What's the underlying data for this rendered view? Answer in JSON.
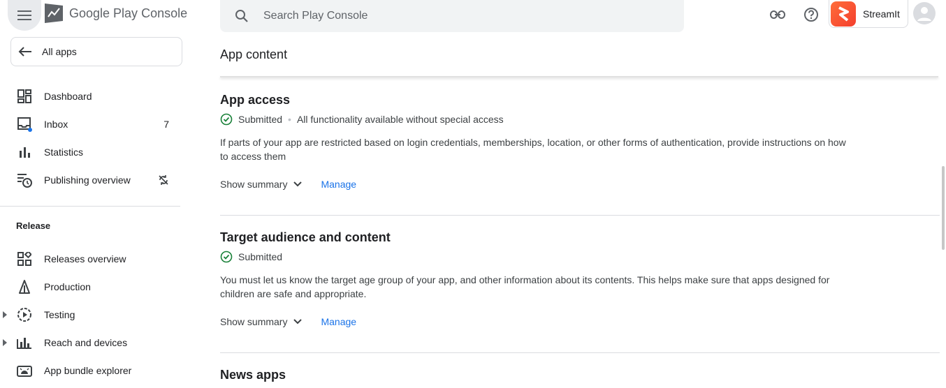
{
  "header": {
    "brand_google": "Google Play",
    "brand_console": "Console",
    "search_placeholder": "Search Play Console",
    "app_name": "StreamIt"
  },
  "sidebar": {
    "all_apps": "All apps",
    "items": [
      {
        "label": "Dashboard",
        "icon": "dashboard-icon"
      },
      {
        "label": "Inbox",
        "icon": "inbox-icon",
        "count": "7"
      },
      {
        "label": "Statistics",
        "icon": "bar-chart-icon"
      },
      {
        "label": "Publishing overview",
        "icon": "schedule-list-icon"
      }
    ],
    "release_label": "Release",
    "release_items": [
      {
        "label": "Releases overview",
        "icon": "releases-overview-icon"
      },
      {
        "label": "Production",
        "icon": "production-icon"
      },
      {
        "label": "Testing",
        "icon": "testing-icon"
      },
      {
        "label": "Reach and devices",
        "icon": "reach-devices-icon"
      },
      {
        "label": "App bundle explorer",
        "icon": "android-icon"
      }
    ]
  },
  "main": {
    "title": "App content",
    "sections": [
      {
        "title": "App access",
        "status": "Submitted",
        "status_detail": "All functionality available without special access",
        "description": "If parts of your app are restricted based on login credentials, memberships, location, or other forms of authentication, provide instructions on how to access them",
        "show_summary": "Show summary",
        "manage": "Manage"
      },
      {
        "title": "Target audience and content",
        "status": "Submitted",
        "description": "You must let us know the target age group of your app, and other information about its contents. This helps make sure that apps designed for children are safe and appropriate.",
        "show_summary": "Show summary",
        "manage": "Manage"
      },
      {
        "title": "News apps"
      }
    ]
  },
  "colors": {
    "accent": "#1a73e8",
    "success": "#188038",
    "app_icon": "#f4511e"
  }
}
